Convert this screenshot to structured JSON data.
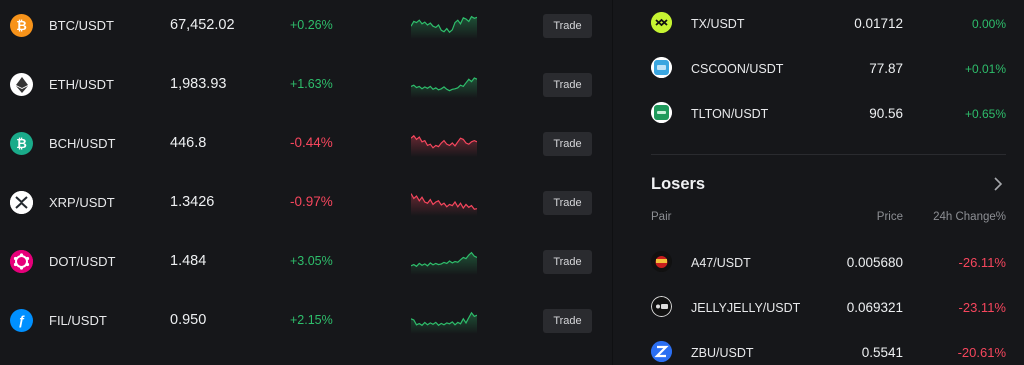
{
  "markets": [
    {
      "pair": "BTC/USDT",
      "price": "67,452.02",
      "change": "+0.26%",
      "direction": "up",
      "icon": "btc-icon",
      "icon_glyph": "₿",
      "icon_color": "#f7931a",
      "trade_label": "Trade",
      "spark": [
        0.55,
        0.35,
        0.4,
        0.3,
        0.45,
        0.38,
        0.5,
        0.42,
        0.55,
        0.6,
        0.5,
        0.72,
        0.78,
        0.65,
        0.8,
        0.7,
        0.4,
        0.3,
        0.45,
        0.2,
        0.25,
        0.35,
        0.15,
        0.22,
        0.18
      ]
    },
    {
      "pair": "ETH/USDT",
      "price": "1,983.93",
      "change": "+1.63%",
      "direction": "up",
      "icon": "eth-icon",
      "icon_glyph": "◆",
      "icon_color": "#ffffff",
      "trade_label": "Trade",
      "spark": [
        0.6,
        0.55,
        0.65,
        0.6,
        0.7,
        0.62,
        0.68,
        0.6,
        0.72,
        0.66,
        0.74,
        0.7,
        0.62,
        0.72,
        0.78,
        0.72,
        0.7,
        0.66,
        0.55,
        0.6,
        0.45,
        0.3,
        0.4,
        0.25,
        0.3
      ]
    },
    {
      "pair": "BCH/USDT",
      "price": "446.8",
      "change": "-0.44%",
      "direction": "down",
      "icon": "bch-icon",
      "icon_glyph": "₿",
      "icon_color": "#1aab8a",
      "trade_label": "Trade",
      "spark": [
        0.3,
        0.2,
        0.35,
        0.25,
        0.45,
        0.4,
        0.6,
        0.55,
        0.7,
        0.6,
        0.65,
        0.5,
        0.4,
        0.55,
        0.6,
        0.5,
        0.62,
        0.45,
        0.3,
        0.35,
        0.5,
        0.55,
        0.45,
        0.4,
        0.45
      ]
    },
    {
      "pair": "XRP/USDT",
      "price": "1.3426",
      "change": "-0.97%",
      "direction": "down",
      "icon": "xrp-icon",
      "icon_glyph": "✕",
      "icon_color": "#23292f",
      "trade_label": "Trade",
      "spark": [
        0.15,
        0.35,
        0.25,
        0.45,
        0.3,
        0.5,
        0.55,
        0.4,
        0.6,
        0.5,
        0.45,
        0.62,
        0.55,
        0.7,
        0.6,
        0.65,
        0.5,
        0.7,
        0.55,
        0.75,
        0.6,
        0.72,
        0.65,
        0.8,
        0.78
      ]
    },
    {
      "pair": "DOT/USDT",
      "price": "1.484",
      "change": "+3.05%",
      "direction": "up",
      "icon": "dot-icon",
      "icon_glyph": "●",
      "icon_color": "#e6007a",
      "trade_label": "Trade",
      "spark": [
        0.7,
        0.65,
        0.72,
        0.6,
        0.68,
        0.62,
        0.7,
        0.58,
        0.66,
        0.6,
        0.65,
        0.62,
        0.56,
        0.6,
        0.5,
        0.58,
        0.52,
        0.55,
        0.45,
        0.35,
        0.4,
        0.25,
        0.15,
        0.3,
        0.35
      ]
    },
    {
      "pair": "FIL/USDT",
      "price": "0.950",
      "change": "+2.15%",
      "direction": "up",
      "icon": "fil-icon",
      "icon_glyph": "ƒ",
      "icon_color": "#0090ff",
      "trade_label": "Trade",
      "spark": [
        0.45,
        0.5,
        0.7,
        0.65,
        0.72,
        0.6,
        0.7,
        0.62,
        0.68,
        0.6,
        0.72,
        0.64,
        0.7,
        0.62,
        0.66,
        0.58,
        0.7,
        0.6,
        0.66,
        0.45,
        0.62,
        0.4,
        0.2,
        0.35,
        0.3
      ]
    }
  ],
  "gainers": [
    {
      "pair": "TX/USDT",
      "price": "0.01712",
      "change": "0.00%",
      "direction": "up",
      "icon": "tx-icon",
      "icon_color": "#c6f432"
    },
    {
      "pair": "CSCOON/USDT",
      "price": "77.87",
      "change": "+0.01%",
      "direction": "up",
      "icon": "cscoon-icon",
      "icon_color": "#3aa6e0"
    },
    {
      "pair": "TLTON/USDT",
      "price": "90.56",
      "change": "+0.65%",
      "direction": "up",
      "icon": "tlton-icon",
      "icon_color": "#1f9a5c"
    }
  ],
  "losers": {
    "title": "Losers",
    "col_pair": "Pair",
    "col_price": "Price",
    "col_change": "24h Change%",
    "rows": [
      {
        "pair": "A47/USDT",
        "price": "0.005680",
        "change": "-26.11%",
        "direction": "down",
        "icon": "a47-icon",
        "icon_color": "#c81e1e"
      },
      {
        "pair": "JELLYJELLY/USDT",
        "price": "0.069321",
        "change": "-23.11%",
        "direction": "down",
        "icon": "jellyjelly-icon",
        "icon_color": "#111111"
      },
      {
        "pair": "ZBU/USDT",
        "price": "0.5541",
        "change": "-20.61%",
        "direction": "down",
        "icon": "zbu-icon",
        "icon_color": "#2b6ff2"
      }
    ]
  },
  "colors": {
    "up": "#2ebd6b",
    "down": "#f6465d",
    "bg": "#16171a",
    "button": "#2a2b2f"
  }
}
